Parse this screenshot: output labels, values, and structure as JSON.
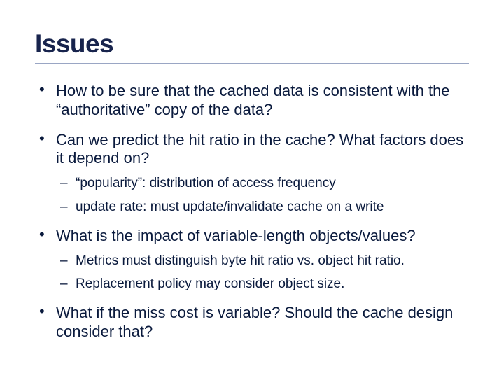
{
  "title": "Issues",
  "bullets": [
    {
      "text": "How to be sure that the cached data is consistent with the “authoritative” copy of the data?"
    },
    {
      "text": "Can we predict the hit ratio in the cache?  What factors does it depend on?",
      "sub": [
        "“popularity”: distribution of access frequency",
        "update rate: must update/invalidate cache on a write"
      ]
    },
    {
      "text": "What is the impact of variable-length objects/values?",
      "sub": [
        "Metrics must distinguish byte hit ratio vs. object hit ratio.",
        "Replacement policy may consider object size."
      ]
    },
    {
      "text": "What if the miss cost is variable?  Should the cache design consider that?"
    }
  ]
}
